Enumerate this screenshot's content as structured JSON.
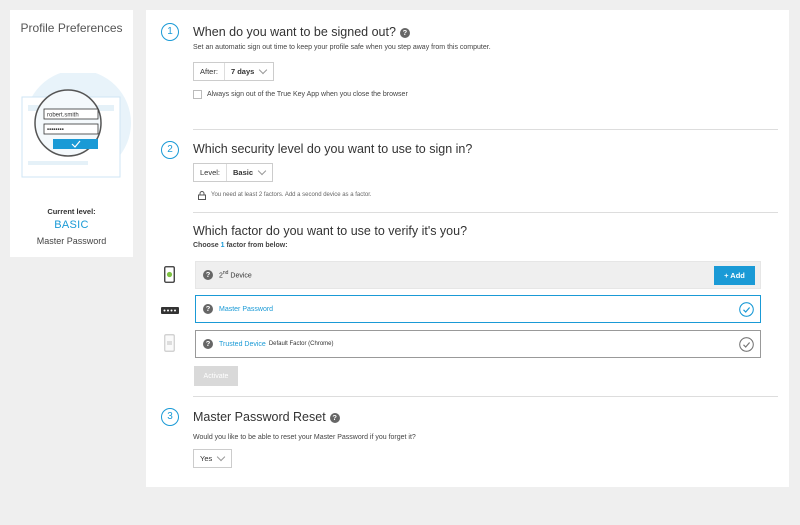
{
  "sidebar": {
    "title": "Profile Preferences",
    "illustration": {
      "username": "robert.smith",
      "password": "••••••••"
    },
    "current_level_label": "Current level:",
    "current_level": "BASIC",
    "current_factor": "Master Password"
  },
  "section1": {
    "number": "1",
    "heading": "When do you want to be signed out?",
    "help": "?",
    "description": "Set an automatic sign out time to keep your profile safe when you step away from this computer.",
    "select_label": "After:",
    "select_value": "7 days",
    "checkbox_label": "Always sign out of the True Key App when you close the browser"
  },
  "section2": {
    "number": "2",
    "heading": "Which security level do you want to use to sign in?",
    "select_label": "Level:",
    "select_value": "Basic",
    "note": "You need at least 2 factors. Add a second device as a factor.",
    "factor_heading": "Which factor do you want to use to verify it's you?",
    "choose_prefix": "Choose ",
    "choose_count": "1",
    "choose_suffix": " factor from below:",
    "factors": [
      {
        "help": "?",
        "label": "2",
        "sup": "nd",
        "label_rest": " Device",
        "button": "+ Add"
      },
      {
        "help": "?",
        "label": "Master Password"
      },
      {
        "help": "?",
        "label": "Trusted Device",
        "extra": "Default Factor (Chrome)"
      }
    ],
    "activate_button": "Activate"
  },
  "section3": {
    "number": "3",
    "heading": "Master Password Reset",
    "help": "?",
    "question": "Would you like to be able to reset your Master Password if you forget it?",
    "select_value": "Yes"
  },
  "colors": {
    "accent": "#1a9ad6",
    "background": "#efefef",
    "panel": "#ffffff"
  }
}
